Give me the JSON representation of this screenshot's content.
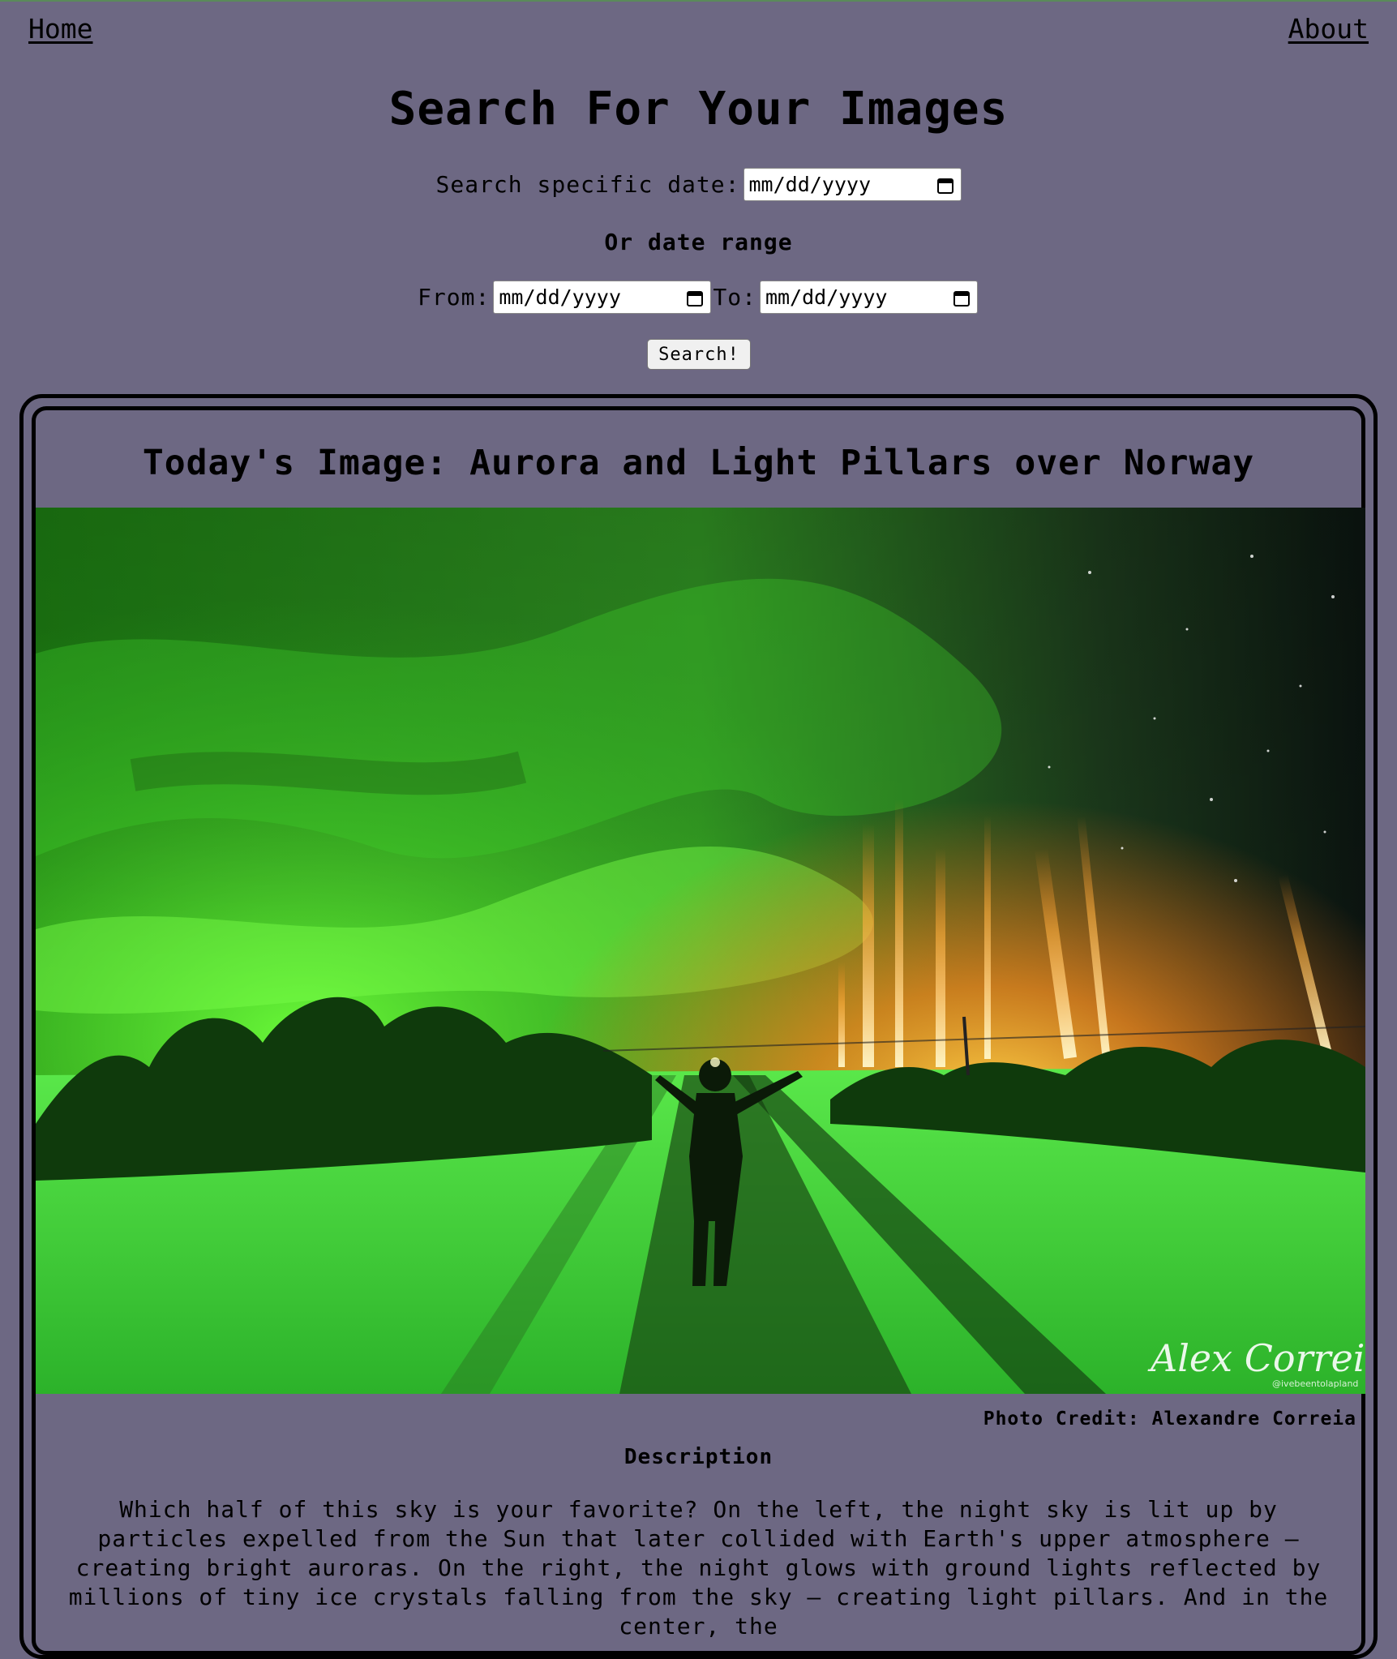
{
  "nav": {
    "home": "Home",
    "about": "About"
  },
  "header": {
    "title": "Search For Your Images"
  },
  "search": {
    "specific_label": "Search specific date:",
    "specific_placeholder": "mm/dd/yyyy",
    "range_heading": "Or date range",
    "from_label": "From:",
    "from_placeholder": "mm/dd/yyyy",
    "to_label": "To:",
    "to_placeholder": "mm/dd/yyyy",
    "button_label": "Search!"
  },
  "image_card": {
    "title": "Today's Image: Aurora and Light Pillars over Norway",
    "watermark": "Alex Correia",
    "watermark_handle": "@ivebeentolapland",
    "credit": "Photo Credit: Alexandre Correia",
    "description_heading": "Description",
    "description": "Which half of this sky is your favorite? On the left, the night sky is lit up by particles expelled from the Sun that later collided with Earth's upper atmosphere — creating bright auroras. On the right, the night glows with ground lights reflected by millions of tiny ice crystals falling from the sky — creating light pillars. And in the center, the"
  },
  "colors": {
    "page_background": "#6d6883",
    "aurora_green": "#33dd22",
    "pillar_orange": "#ff9a2a"
  },
  "icons": {
    "date_picker": "calendar-icon"
  }
}
